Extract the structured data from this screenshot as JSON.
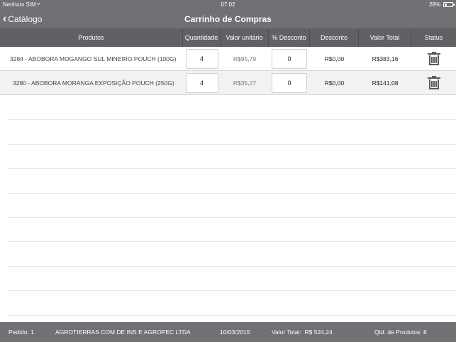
{
  "status_bar": {
    "carrier": "Nenhum SIM",
    "time": "07:02",
    "battery": "28%"
  },
  "nav": {
    "back_label": "Catálogo",
    "title": "Carrinho de Compras"
  },
  "table": {
    "headers": {
      "produtos": "Produtos",
      "quantidade": "Quantidade",
      "valor_unitario": "Valor unitário",
      "pct_desconto": "% Desconto",
      "desconto": "Desconto",
      "valor_total": "Valor Total",
      "status": "Status"
    },
    "rows": [
      {
        "produto": "3284 - ABOBORA MOGANGO SUL MINEIRO POUCH (100G)",
        "quantidade": "4",
        "valor_unitario": "R$95,79",
        "pct_desconto": "0",
        "desconto": "R$0,00",
        "valor_total": "R$383,16"
      },
      {
        "produto": "3280 - ABOBORA MORANGA EXPOSIÇÃO POUCH (250G)",
        "quantidade": "4",
        "valor_unitario": "R$35,27",
        "pct_desconto": "0",
        "desconto": "R$0,00",
        "valor_total": "R$141,08"
      }
    ]
  },
  "footer": {
    "pedido_label": "Pedido:",
    "pedido_value": "1",
    "cliente": "AGROTIERRAS COM DE INS E AGROPEC LTDA",
    "data": "10/03/2015",
    "valor_total_label": "Valor Total:",
    "valor_total_value": "R$ 524,24",
    "qtd_label": "Qtd. de Produtos:",
    "qtd_value": "8"
  },
  "icons": {
    "back": "chevron-left-icon",
    "delete": "trash-icon",
    "wifi": "wifi-icon",
    "battery": "battery-icon"
  }
}
